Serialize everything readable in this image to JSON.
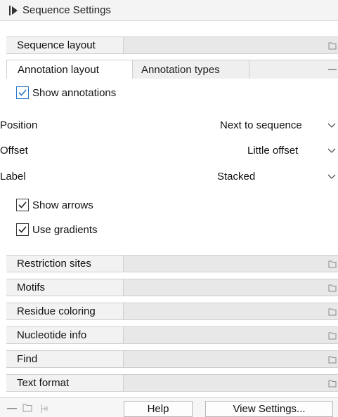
{
  "header": {
    "title": "Sequence Settings",
    "icon": "collapse-panel-icon"
  },
  "sections_top": [
    {
      "label": "Sequence layout"
    }
  ],
  "annotation": {
    "tabs": [
      {
        "label": "Annotation layout",
        "active": true
      },
      {
        "label": "Annotation types",
        "active": false
      }
    ],
    "show_annotations": {
      "label": "Show annotations",
      "checked": true
    },
    "position": {
      "label": "Position",
      "value": "Next to sequence"
    },
    "offset": {
      "label": "Offset",
      "value": "Little offset"
    },
    "label_field": {
      "label": "Label",
      "value": "Stacked"
    },
    "show_arrows": {
      "label": "Show arrows",
      "checked": true
    },
    "use_gradients": {
      "label": "Use gradients",
      "checked": true
    }
  },
  "sections_bottom": [
    {
      "label": "Restriction sites"
    },
    {
      "label": "Motifs"
    },
    {
      "label": "Residue coloring"
    },
    {
      "label": "Nucleotide info"
    },
    {
      "label": "Find"
    },
    {
      "label": "Text format"
    }
  ],
  "footer": {
    "help_label": "Help",
    "view_settings_label": "View Settings..."
  },
  "colors": {
    "accent": "#2a78c8",
    "bar_bg": "#e7e7e7"
  }
}
